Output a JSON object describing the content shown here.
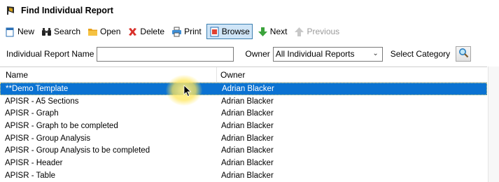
{
  "window": {
    "title": "Find Individual Report",
    "icon": "report-app-icon"
  },
  "toolbar": {
    "new_label": "New",
    "search_label": "Search",
    "open_label": "Open",
    "delete_label": "Delete",
    "print_label": "Print",
    "browse_label": "Browse",
    "next_label": "Next",
    "previous_label": "Previous"
  },
  "filters": {
    "name_label": "Individual Report Name",
    "name_value": "",
    "owner_label": "Owner",
    "owner_value": "All Individual Reports",
    "category_label": "Select Category"
  },
  "grid": {
    "columns": [
      "Name",
      "Owner"
    ],
    "rows": [
      {
        "name": "**Demo Template",
        "owner": "Adrian Blacker",
        "selected": true
      },
      {
        "name": "APISR - A5 Sections",
        "owner": "Adrian Blacker"
      },
      {
        "name": "APISR - Graph",
        "owner": "Adrian Blacker"
      },
      {
        "name": "APISR - Graph to be completed",
        "owner": "Adrian Blacker"
      },
      {
        "name": "APISR - Group Analysis",
        "owner": "Adrian Blacker"
      },
      {
        "name": "APISR - Group Analysis to be completed",
        "owner": "Adrian Blacker"
      },
      {
        "name": "APISR - Header",
        "owner": "Adrian Blacker"
      },
      {
        "name": "APISR - Table",
        "owner": "Adrian Blacker"
      }
    ]
  },
  "colors": {
    "selection": "#0a72d2",
    "active_button": "#cfe5f7"
  }
}
